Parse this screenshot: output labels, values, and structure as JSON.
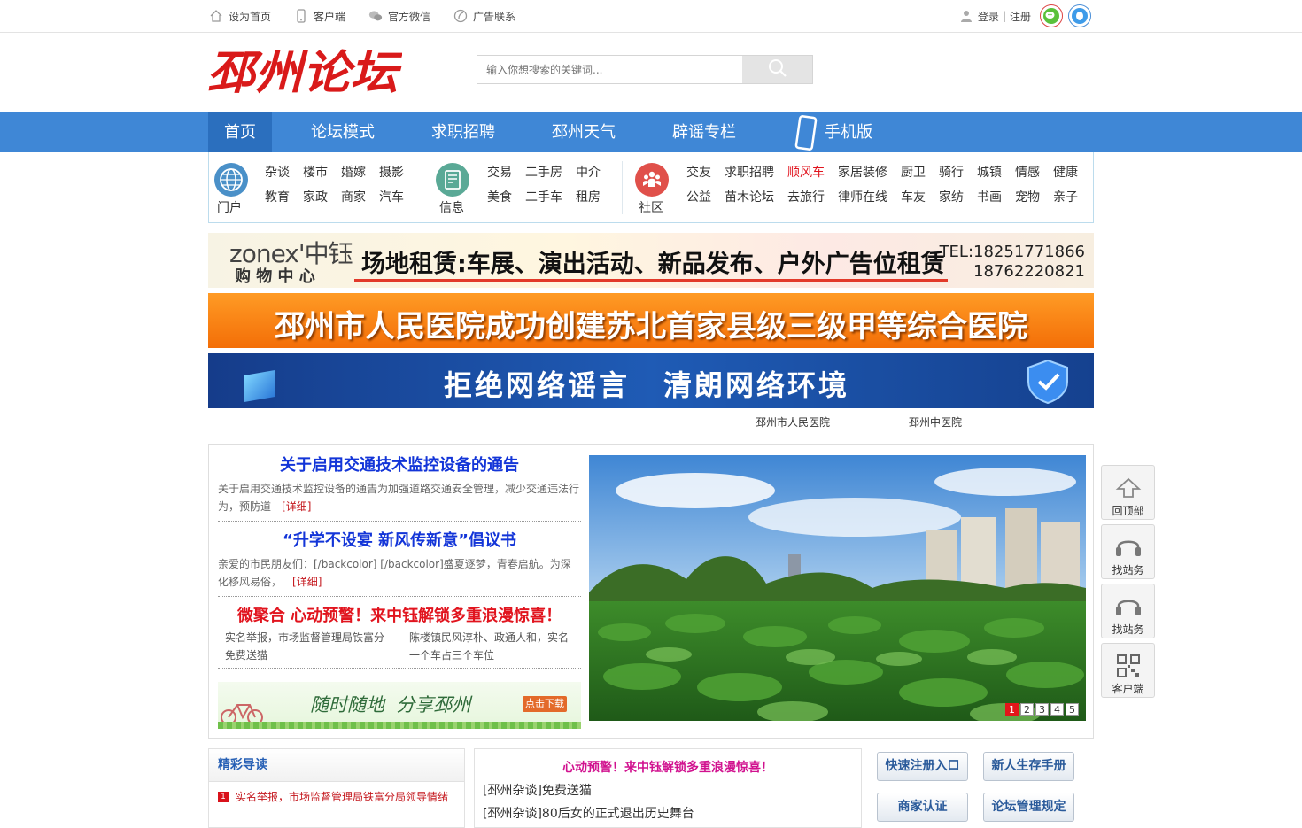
{
  "topbar": {
    "set_home": "设为首页",
    "client": "客户端",
    "wechat": "官方微信",
    "ads": "广告联系",
    "login": "登录",
    "separator": "|",
    "register": "注册"
  },
  "header": {
    "logo_text": "邳州论坛",
    "search_placeholder": "输入你想搜索的关键词..."
  },
  "nav": {
    "items": [
      "首页",
      "论坛模式",
      "求职招聘",
      "邳州天气",
      "辟谣专栏",
      "手机版"
    ]
  },
  "categories": {
    "portal": {
      "title": "门户",
      "links": [
        "杂谈",
        "楼市",
        "婚嫁",
        "摄影",
        "教育",
        "家政",
        "商家",
        "汽车"
      ]
    },
    "info": {
      "title": "信息",
      "links": [
        "交易",
        "二手房",
        "中介",
        "美食",
        "二手车",
        "租房"
      ]
    },
    "community": {
      "title": "社区",
      "links": [
        "交友",
        "求职招聘",
        "顺风车",
        "家居装修",
        "厨卫",
        "骑行",
        "城镇",
        "情感",
        "健康",
        "公益",
        "苗木论坛",
        "去旅行",
        "律师在线",
        "车友",
        "家纺",
        "书画",
        "宠物",
        "亲子"
      ],
      "highlight": "顺风车"
    }
  },
  "banners": {
    "b1_brand": "zonex'中钰",
    "b1_sub": "购 物 中 心",
    "b1_main": "场地租赁:车展、演出活动、新品发布、户外广告位租赁",
    "b1_tel1": "TEL:18251771866",
    "b1_tel2": "18762220821",
    "b2_text": "邳州市人民医院成功创建苏北首家县级三级甲等综合医院",
    "b3_text_a": "拒绝网络谣言",
    "b3_text_b": "清朗网络环境"
  },
  "hospital_links": [
    "邳州市人民医院",
    "邳州中医院"
  ],
  "headlines": {
    "h1": {
      "title": "关于启用交通技术监控设备的通告",
      "desc": "关于启用交通技术监控设备的通告为加强道路交通安全管理，减少交通违法行为，预防道",
      "more": "[详细]"
    },
    "h2": {
      "title": "“升学不设宴 新风传新意”倡议书",
      "desc": "亲爱的市民朋友们：[/backcolor] [/backcolor]盛夏逐梦，青春启航。为深化移风易俗，",
      "more": "[详细]"
    },
    "h3": {
      "title": "微聚合  心动预警！来中钰解锁多重浪漫惊喜！",
      "col1": "实名举报，市场监督管理局铁富分免费送猫",
      "col2": "陈楼镇民风淳朴、政通人和，实名一个车占三个车位"
    },
    "download": {
      "text": "随时随地  分享邳州",
      "button": "点击下载"
    }
  },
  "slider": {
    "pages": [
      "1",
      "2",
      "3",
      "4",
      "5"
    ],
    "active": 1
  },
  "float_bar": [
    "回顶部",
    "找站务",
    "找站务",
    "客户端"
  ],
  "featured": {
    "title": "精彩导读",
    "items": [
      {
        "num": "1",
        "text": "实名举报，市场监督管理局铁富分局领导情绪"
      }
    ]
  },
  "center": {
    "headline": "心动预警！来中钰解锁多重浪漫惊喜！",
    "items": [
      "[邳州杂谈]免费送猫",
      "[邳州杂谈]80后女的正式退出历史舞台"
    ]
  },
  "quick_buttons": [
    "快速注册入口",
    "新人生存手册",
    "商家认证",
    "论坛管理规定"
  ],
  "colors": {
    "nav": "#3f87d6",
    "nav_active": "#2b6fbe",
    "headline_blue": "#1335d8",
    "headline_red": "#e1141e",
    "accent_red": "#c4161c"
  }
}
